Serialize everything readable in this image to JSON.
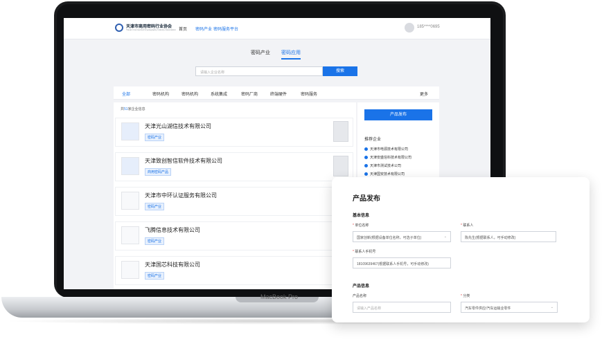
{
  "device": {
    "brand": "MacBook Pro"
  },
  "topbar": {
    "logo_text": "天津市商用密码行业协会",
    "logo_sub": "Tianjin Commercial Cryptography Industry Association",
    "nav": [
      "首页",
      "密码产业",
      "密码服务平台"
    ],
    "phone": "185****0695"
  },
  "tabs": [
    "密码产业",
    "密码应用"
  ],
  "search": {
    "placeholder": "请输入企业名称",
    "button": "搜索"
  },
  "filters": [
    "全部",
    "密码机构",
    "密码机构",
    "系统集成",
    "密码厂商",
    "终端硬件",
    "密码服务"
  ],
  "filter_more": "更多",
  "list": {
    "total_prefix": "共",
    "total_count": "51",
    "total_suffix": "家企业信息",
    "companies": [
      {
        "name": "天津光山湖信技术有限公司",
        "tag": "密码产业"
      },
      {
        "name": "天津致创智信软件技术有限公司",
        "tag": "商用密码产品"
      },
      {
        "name": "天津市中环认证服务有限公司",
        "tag": "密码产业"
      },
      {
        "name": "飞腾信息技术有限公司",
        "tag": "密码产业"
      },
      {
        "name": "天津国芯科技有限公司",
        "tag": "密码产业"
      }
    ]
  },
  "side": {
    "publish_button": "产品发布",
    "title": "推荐企业",
    "items": [
      "天津市电源技术有限公司",
      "天津安盛信科技术有限公司",
      "天津市测试技术公司",
      "天津国安技术有限公司"
    ]
  },
  "form": {
    "title": "产品发布",
    "basic_section": "基本信息",
    "unit_label": "单位名称",
    "unit_value": "国家创新(根据设备单位名称，可选子单位)",
    "contact_label": "联系人",
    "contact_value": "陈先生(根据联系人，可手动修改)",
    "phone_label": "联系人手机号",
    "phone_value": "18109639467(根据联系人手机号，可手动修改)",
    "product_section": "产品信息",
    "pname_label": "产品名称",
    "pname_placeholder": "请输入产品名称",
    "category_label": "分类",
    "category_value": "汽车零件供应/汽车运输业零件"
  }
}
